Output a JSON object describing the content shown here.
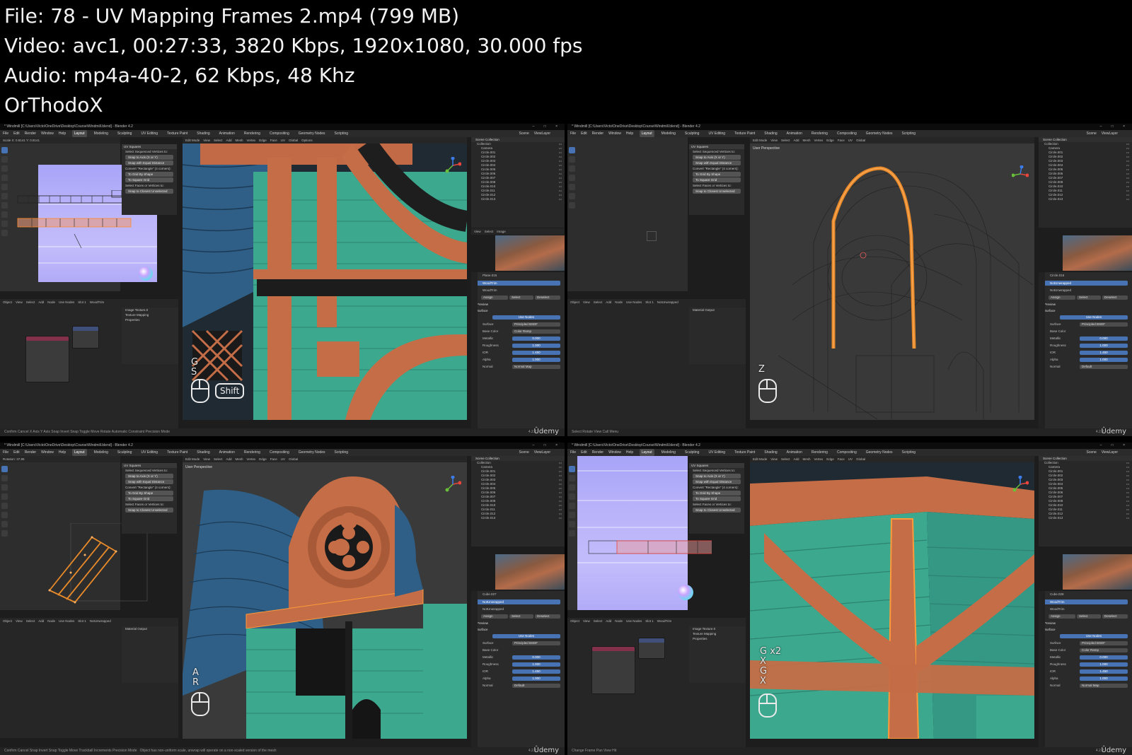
{
  "info": {
    "lines": [
      "File: 78 - UV Mapping Frames 2.mp4 (799 MB)",
      "Video: avc1, 00:27:33, 3820 Kbps, 1920x1080, 30.000 fps",
      "Audio: mp4a-40-2, 62 Kbps, 48 Khz",
      "OrThodoX"
    ]
  },
  "app": {
    "window_title": "* Windmill [C:\\Users\\Victo\\OneDrive\\Desktop\\Course\\Windmill.blend] - Blender 4.2",
    "window_controls": "– □ ×",
    "menus": [
      "File",
      "Edit",
      "Render",
      "Window",
      "Help"
    ],
    "workspaces": [
      "Layout",
      "Modeling",
      "Sculpting",
      "UV Editing",
      "Texture Paint",
      "Shading",
      "Animation",
      "Rendering",
      "Compositing",
      "Geometry Nodes",
      "Scripting",
      "+"
    ],
    "active_workspace": "Layout",
    "scene_label": "Scene",
    "view_layer_label": "ViewLayer",
    "version": "4.2.2",
    "watermark": "Ûdemy"
  },
  "uv_panel": {
    "title": "UV Squares",
    "select_label": "Select Sequenced Vertices to:",
    "snap_axis": "Snap to Axis (X or Y)",
    "snap_equal": "Snap with Equal Distance",
    "convert_label": "Convert \"Rectangle\" (4 corners):",
    "to_grid_shape": "To Grid By Shape",
    "to_square_grid": "To Square Grid",
    "select_faces_label": "Select Faces or Vertices to:",
    "snap_closest": "Snap to Closest Unselected"
  },
  "viewport": {
    "perspective": "User Perspective",
    "header_items": [
      "View",
      "Select",
      "Add",
      "Mesh",
      "Vertex",
      "Edge",
      "Face",
      "UV"
    ],
    "edit_mode": "Edit Mode",
    "transform": "Global",
    "options": "Options"
  },
  "uv_editor": {
    "header_items": [
      "View",
      "Select",
      "Image",
      "UV"
    ]
  },
  "node_editor": {
    "header_items": [
      "Object",
      "View",
      "Select",
      "Add",
      "Node"
    ],
    "use_nodes": "Use Nodes",
    "slot": "Slot 1"
  },
  "outliner": {
    "header": "Scene Collection",
    "collection": "Collection",
    "items": [
      "Camera",
      "Circle.001",
      "Circle.002",
      "Circle.003",
      "Circle.004",
      "Circle.005",
      "Circle.006",
      "Circle.007",
      "Circle.008",
      "Circle.010",
      "Circle.011",
      "Circle.012",
      "Circle.013"
    ]
  },
  "properties": {
    "preview": "Preview",
    "surface": "Surface",
    "use_nodes": "Use Nodes",
    "surface_label": "Surface",
    "surface_value": "Principled BSDF",
    "base_color": "Base Color",
    "base_color_value": "Color Ramp",
    "metallic": "Metallic",
    "metallic_value": "0.000",
    "roughness": "Roughness",
    "roughness_value": "1.000",
    "ior": "IOR",
    "ior_value": "1.450",
    "alpha": "Alpha",
    "alpha_value": "1.000",
    "normal": "Normal",
    "normal_value": "Normal Map",
    "normal_default": "Default",
    "assign": "Assign",
    "select": "Select",
    "deselect": "Deselect"
  },
  "frames": [
    {
      "status": "Confirm   Cancel   X Axis   Y Axis   Snap Invert   Snap Toggle   Move   Rotate   Automatic Constraint   Precision Mode",
      "uv_readout": "Scale X: 0.8141   Y: 0.8141",
      "object": "Plane.015",
      "material": "WoodTrim",
      "keys": [
        "G",
        "S"
      ],
      "shift": "Shift",
      "node_panel_label": "Image Texture.0",
      "texture_mapping": "Texture Mapping",
      "node_props": "Properties"
    },
    {
      "status": "Select   Rotate View   Call Menu",
      "object": "Circle.015",
      "material": "NotUnwrapped",
      "keys": [
        "Z"
      ],
      "node_panel_label": "Material Output"
    },
    {
      "status": "Confirm   Cancel   Snap Invert   Snap Toggle   Move   Trackball   Increments   Precision Mode",
      "warning": "Object has non-uniform scale, unwrap will operate on a non-scaled version of the mesh",
      "uv_readout": "Rotation: 37.85",
      "object": "Cube.027",
      "material": "NotUnwrapped",
      "keys": [
        "A",
        "R"
      ],
      "node_panel_label": "Material Output"
    },
    {
      "status": "Change Frame   Pan View   Hit",
      "object": "Cube.028",
      "material": "WoodTrim",
      "keys": [
        "G x2",
        "X",
        "G",
        "X"
      ],
      "node_panel_label": "Image Texture.0"
    }
  ]
}
